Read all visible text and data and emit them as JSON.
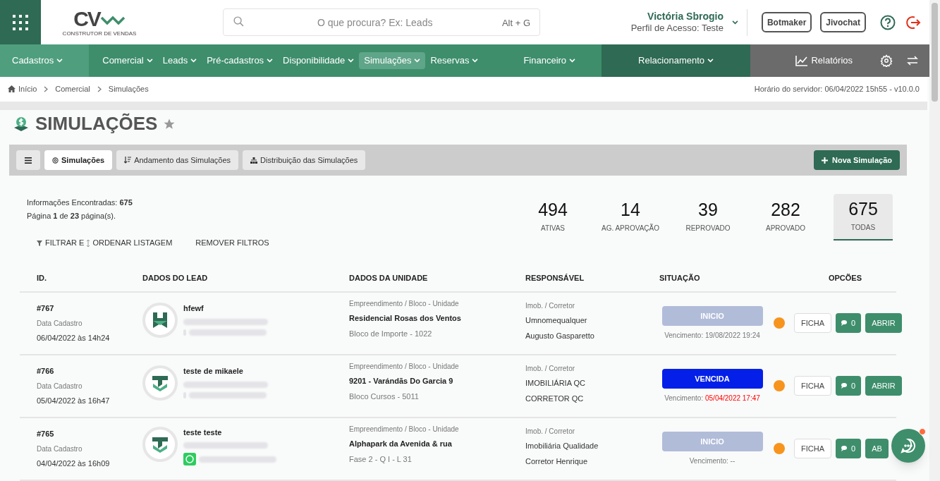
{
  "header": {
    "logo_text": "CV",
    "logo_caption": "CONSTRUTOR DE VENDAS",
    "search": {
      "placeholder": "O que procura? Ex: Leads",
      "shortcut": "Alt + G"
    },
    "user": {
      "name": "Victória Sbrogio",
      "profile": "Perfil de Acesso: Teste"
    },
    "buttons": [
      "Botmaker",
      "Jivochat"
    ]
  },
  "nav": [
    {
      "kind": "light",
      "items": [
        {
          "label": "Cadastros",
          "selected": false
        }
      ]
    },
    {
      "kind": "main",
      "items": [
        {
          "label": "Comercial",
          "selected": false
        },
        {
          "label": "Leads",
          "selected": false
        },
        {
          "label": "Pré-cadastros",
          "selected": false
        },
        {
          "label": "Disponibilidade",
          "selected": false
        },
        {
          "label": "Simulações",
          "selected": true
        },
        {
          "label": "Reservas",
          "selected": false
        }
      ]
    },
    {
      "kind": "main",
      "items": [
        {
          "label": "Financeiro",
          "selected": false
        }
      ]
    },
    {
      "kind": "dark",
      "items": [
        {
          "label": "Relacionamento",
          "selected": false
        }
      ]
    },
    {
      "kind": "tools",
      "items": [
        {
          "label": "Relatórios",
          "selected": false
        }
      ]
    }
  ],
  "breadcrumb": [
    "Início",
    "Comercial",
    "Simulações"
  ],
  "server_time": "Horário do servidor: 06/04/2022 15h55 - v10.0.0",
  "page_title": "SIMULAÇÕES",
  "tabs": [
    {
      "label": "Simulações",
      "selected": true
    },
    {
      "label": "Andamento das Simulações",
      "selected": false
    },
    {
      "label": "Distribuição das Simulações",
      "selected": false
    }
  ],
  "new_button": "Nova Simulação",
  "info": {
    "found": "Informações Encontradas: **675**",
    "page": "Página **1** de **23** página(s)."
  },
  "filters": [
    "FILTRAR E",
    "ORDENAR LISTAGEM",
    "REMOVER FILTROS"
  ],
  "stats": [
    {
      "value": "494",
      "label": "ATIVAS",
      "selected": false
    },
    {
      "value": "14",
      "label": "AG. APROVAÇÃO",
      "selected": false
    },
    {
      "value": "39",
      "label": "REPROVADO",
      "selected": false
    },
    {
      "value": "282",
      "label": "APROVADO",
      "selected": false
    },
    {
      "value": "675",
      "label": "TODAS",
      "selected": true
    }
  ],
  "table": {
    "columns": [
      "ID.",
      "DADOS DO LEAD",
      "DADOS DA UNIDADE",
      "RESPONSÁVEL",
      "SITUAÇÃO",
      "OPCÕES"
    ],
    "rows": [
      {
        "id": "#767",
        "date_label": "Data Cadastro",
        "date": "06/04/2022 às 14h24",
        "avatar": {
          "kind": "h"
        },
        "lead": "hfewf",
        "whatsapp": false,
        "unit_label": "Empreendimento / Bloco - Unidade",
        "unit": "Residencial Rosas dos Ventos",
        "block": "Bloco de Importe - 1022",
        "resp_label": "Imob. / Corretor",
        "agency": "Umnomequalquer",
        "broker": "Augusto Gasparetto",
        "status": {
          "kind": "inicio",
          "label": "INICIO"
        },
        "due_label": "Vencimento:",
        "due": "19/08/2022 19:24",
        "overdue": false,
        "color": "#f7941d",
        "actions": [
          "FICHA",
          "0",
          "ABRIR"
        ]
      },
      {
        "id": "#766",
        "date_label": "Data Cadastro",
        "date": "05/04/2022 às 16h47",
        "avatar": {
          "kind": "t"
        },
        "lead": "teste de mikaele",
        "whatsapp": false,
        "unit_label": "Empreendimento / Bloco - Unidade",
        "unit": "9201 - Varándãs Do Garcia 9",
        "block": "Bloco Cursos - 5011",
        "resp_label": "Imob. / Corretor",
        "agency": "IMOBILIÁRIA QC",
        "broker": "CORRETOR QC",
        "status": {
          "kind": "vencida",
          "label": "VENCIDA"
        },
        "due_label": "Vencimento:",
        "due": "05/04/2022 17:47",
        "overdue": true,
        "color": "#f7941d",
        "actions": [
          "FICHA",
          "0",
          "ABRIR"
        ]
      },
      {
        "id": "#765",
        "date_label": "Data Cadastro",
        "date": "04/04/2022 às 16h09",
        "avatar": {
          "kind": "t"
        },
        "lead": "teste teste",
        "whatsapp": true,
        "unit_label": "Empreendimento / Bloco - Unidade",
        "unit": "Alphapark da Avenida & rua",
        "block": "Fase 2 - Q I - L 31",
        "resp_label": "Imob. / Corretor",
        "agency": "Imobiliária Qualidade",
        "broker": "Corretor Henrique",
        "status": {
          "kind": "inicio",
          "label": "INICIO"
        },
        "due_label": "Vencimento:",
        "due": "--",
        "overdue": false,
        "color": "#f7941d",
        "actions": [
          "FICHA",
          "0",
          "AB"
        ]
      }
    ]
  }
}
